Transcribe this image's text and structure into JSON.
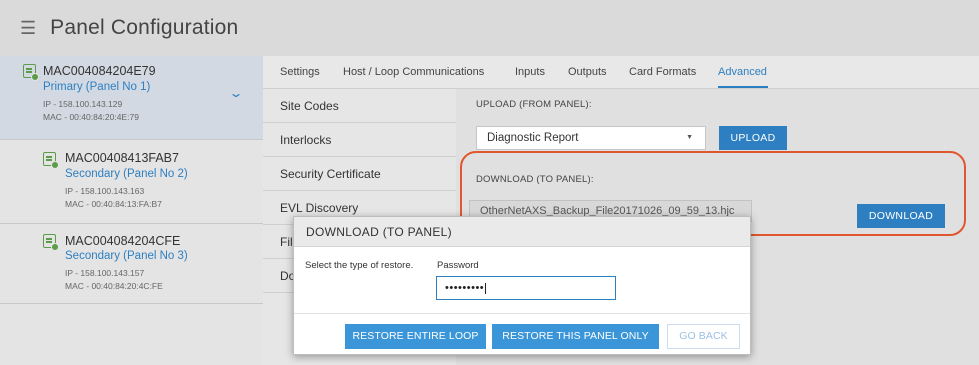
{
  "header": {
    "menu_icon": "hamburger-icon",
    "title": "Panel Configuration"
  },
  "panels": [
    {
      "name": "MAC004084204E79",
      "role": "Primary (Panel No 1)",
      "ip": "IP - 158.100.143.129",
      "mac": "MAC - 00:40:84:20:4E:79",
      "icon": "panel-icon",
      "active": true
    },
    {
      "name": "MAC00408413FAB7",
      "role": "Secondary (Panel No 2)",
      "ip": "IP - 158.100.143.163",
      "mac": "MAC - 00:40:84:13:FA:B7",
      "icon": "panel-icon",
      "active": false
    },
    {
      "name": "MAC004084204CFE",
      "role": "Secondary (Panel No 3)",
      "ip": "IP - 158.100.143.157",
      "mac": "MAC - 00:40:84:20:4C:FE",
      "icon": "panel-icon",
      "active": false
    }
  ],
  "tabs": [
    "Settings",
    "Host / Loop Communications",
    "Inputs",
    "Outputs",
    "Card Formats",
    "Advanced"
  ],
  "active_tab": "Advanced",
  "subnav": [
    "Site Codes",
    "Interlocks",
    "Security Certificate",
    "EVL Discovery",
    "Fil",
    "Do"
  ],
  "upload": {
    "label": "UPLOAD (FROM PANEL):",
    "select_value": "Diagnostic Report",
    "button": "UPLOAD"
  },
  "download": {
    "label": "DOWNLOAD (TO PANEL):",
    "file_value": "OtherNetAXS_Backup_File20171026_09_59_13.hjc",
    "button": "DOWNLOAD"
  },
  "modal": {
    "title": "DOWNLOAD (TO PANEL)",
    "prompt": "Select the type of restore.",
    "password_label": "Password",
    "password_value": "•••••••••",
    "buttons": {
      "restore_all": "RESTORE ENTIRE LOOP",
      "restore_one": "RESTORE THIS PANEL ONLY",
      "back": "GO BACK"
    }
  },
  "colors": {
    "accent": "#2d7fc1",
    "highlight": "#e0562e",
    "panel_icon": "#5c9b4a"
  }
}
